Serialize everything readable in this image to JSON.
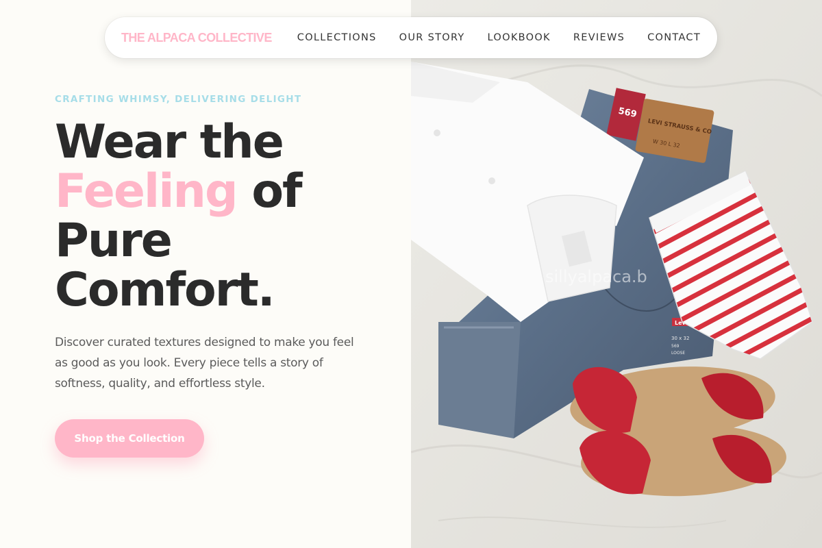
{
  "nav": {
    "brand": "THE ALPACA COLLECTIVE",
    "items": [
      {
        "label": "COLLECTIONS"
      },
      {
        "label": "OUR STORY"
      },
      {
        "label": "LOOKBOOK"
      },
      {
        "label": "REVIEWS"
      },
      {
        "label": "CONTACT"
      }
    ]
  },
  "hero": {
    "eyebrow": "CRAFTING WHIMSY, DELIVERING DELIGHT",
    "headline": {
      "line1": "Wear the",
      "accent": "Feeling",
      "line2_rest": " of",
      "line3": "Pure",
      "line4": "Comfort."
    },
    "lede": "Discover curated textures designed to make you feel as good as you look. Every piece tells a story of softness, quality, and effortless style.",
    "cta_label": "Shop the Collection"
  },
  "photo": {
    "watermark": "sillyalpaca.b",
    "jeans_tag_size": "569",
    "leather_patch_text": "LEVI STRAUSS & CO",
    "leather_patch_size": "W 30 L 32",
    "jeans_tab": "Levi's",
    "pocket_label": "30 x 32 569 LOOSE STRAIGHT"
  },
  "colors": {
    "brand_pink": "#ffb6c8",
    "eyebrow_blue": "#a6dde8",
    "headline_dark": "#2b2b2b",
    "body_gray": "#5b5b5b",
    "page_bg": "#fdfcf8"
  }
}
